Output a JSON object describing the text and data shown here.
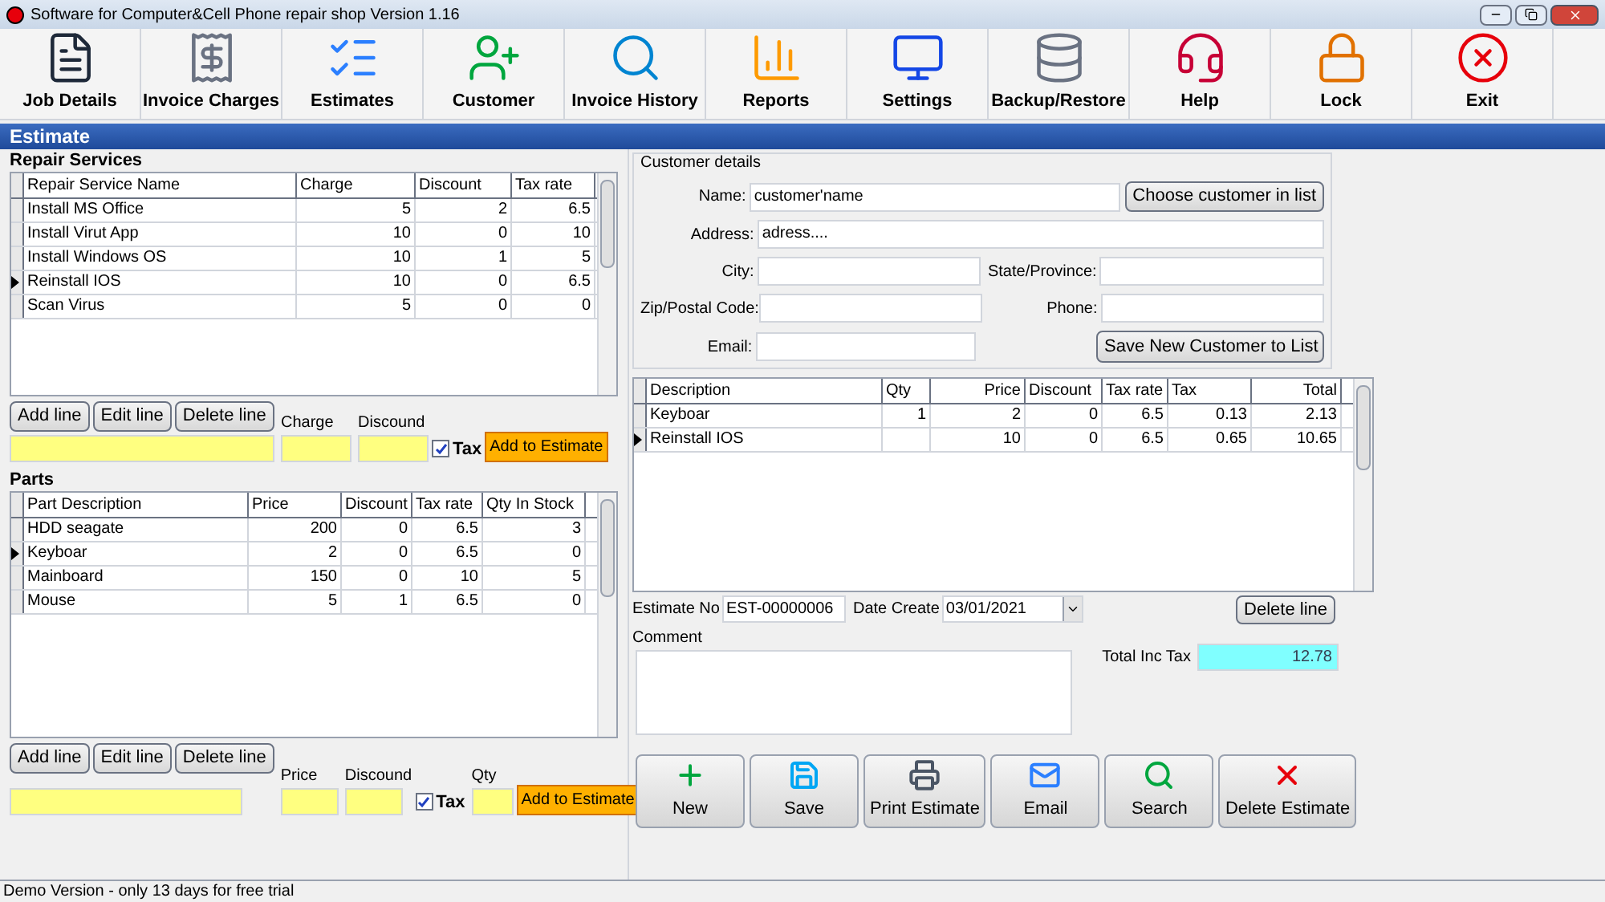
{
  "window": {
    "title": "Software for Computer&Cell Phone repair shop Version 1.16"
  },
  "toolbar": [
    {
      "label": "Job Details"
    },
    {
      "label": "Invoice Charges"
    },
    {
      "label": "Estimates"
    },
    {
      "label": "Customer"
    },
    {
      "label": "Invoice History"
    },
    {
      "label": "Reports"
    },
    {
      "label": "Settings"
    },
    {
      "label": "Backup/Restore"
    },
    {
      "label": "Help"
    },
    {
      "label": "Lock"
    },
    {
      "label": "Exit"
    }
  ],
  "section_title": "Estimate",
  "repair_services": {
    "title": "Repair Services",
    "columns": [
      "Repair Service Name",
      "Charge",
      "Discount",
      "Tax rate"
    ],
    "rows": [
      {
        "cells": [
          "Install MS Office",
          "5",
          "2",
          "6.5"
        ],
        "selected": false
      },
      {
        "cells": [
          "Install Virut App",
          "10",
          "0",
          "10"
        ],
        "selected": false
      },
      {
        "cells": [
          "Install Windows OS",
          "10",
          "1",
          "5"
        ],
        "selected": false
      },
      {
        "cells": [
          "Reinstall IOS",
          "10",
          "0",
          "6.5"
        ],
        "selected": true
      },
      {
        "cells": [
          "Scan Virus",
          "5",
          "0",
          "0"
        ],
        "selected": false
      }
    ],
    "buttons": [
      "Add line",
      "Edit line",
      "Delete line"
    ],
    "field_labels": [
      "Charge",
      "Discound"
    ],
    "tax": {
      "label": "Tax",
      "checked": true
    },
    "add_button": "Add to Estimate"
  },
  "parts": {
    "title": "Parts",
    "columns": [
      "Part Description",
      "Price",
      "Discount",
      "Tax rate",
      "Qty In Stock"
    ],
    "rows": [
      {
        "cells": [
          "HDD seagate",
          "200",
          "0",
          "6.5",
          "3"
        ],
        "selected": false
      },
      {
        "cells": [
          "Keyboar",
          "2",
          "0",
          "6.5",
          "0"
        ],
        "selected": true
      },
      {
        "cells": [
          "Mainboard",
          "150",
          "0",
          "10",
          "5"
        ],
        "selected": false
      },
      {
        "cells": [
          "Mouse",
          "5",
          "1",
          "6.5",
          "0"
        ],
        "selected": false
      }
    ],
    "buttons": [
      "Add line",
      "Edit line",
      "Delete line"
    ],
    "field_labels": [
      "Price",
      "Discound"
    ],
    "tax": {
      "label": "Tax",
      "checked": true
    },
    "qty_label": "Qty",
    "add_button": "Add to Estimate"
  },
  "customer": {
    "title": "Customer details",
    "fields": [
      {
        "label": "Name:",
        "value": "customer'name"
      },
      {
        "label": "Address:",
        "value": "adress...."
      },
      {
        "label": "City:"
      },
      {
        "label": "State/Province:"
      },
      {
        "label": "Zip/Postal Code:"
      },
      {
        "label": "Phone:"
      },
      {
        "label": "Email:"
      }
    ],
    "choose_button": "Choose customer in list",
    "save_button": "Save New Customer to List"
  },
  "estimate_table": {
    "columns": [
      "Description",
      "Qty",
      "Price",
      "Discount",
      "Tax rate",
      "Tax",
      "Total"
    ],
    "rows": [
      {
        "cells": [
          "Keyboar",
          "1",
          "2",
          "0",
          "6.5",
          "0.13",
          "2.13"
        ],
        "selected": false
      },
      {
        "cells": [
          "Reinstall IOS",
          "",
          "10",
          "0",
          "6.5",
          "0.65",
          "10.65"
        ],
        "selected": true
      }
    ]
  },
  "estimate_no": {
    "label": "Estimate No",
    "value": "EST-00000006"
  },
  "date_create": {
    "label": "Date Create",
    "value": "03/01/2021"
  },
  "delete_line": "Delete line",
  "comment": {
    "label": "Comment"
  },
  "total": {
    "label": "Total Inc Tax",
    "value": "12.78"
  },
  "actions": [
    {
      "label": "New"
    },
    {
      "label": "Save"
    },
    {
      "label": "Print Estimate"
    },
    {
      "label": "Email"
    },
    {
      "label": "Search"
    },
    {
      "label": "Delete Estimate"
    }
  ],
  "status_bar": "Demo Version - only 13 days for free trial"
}
